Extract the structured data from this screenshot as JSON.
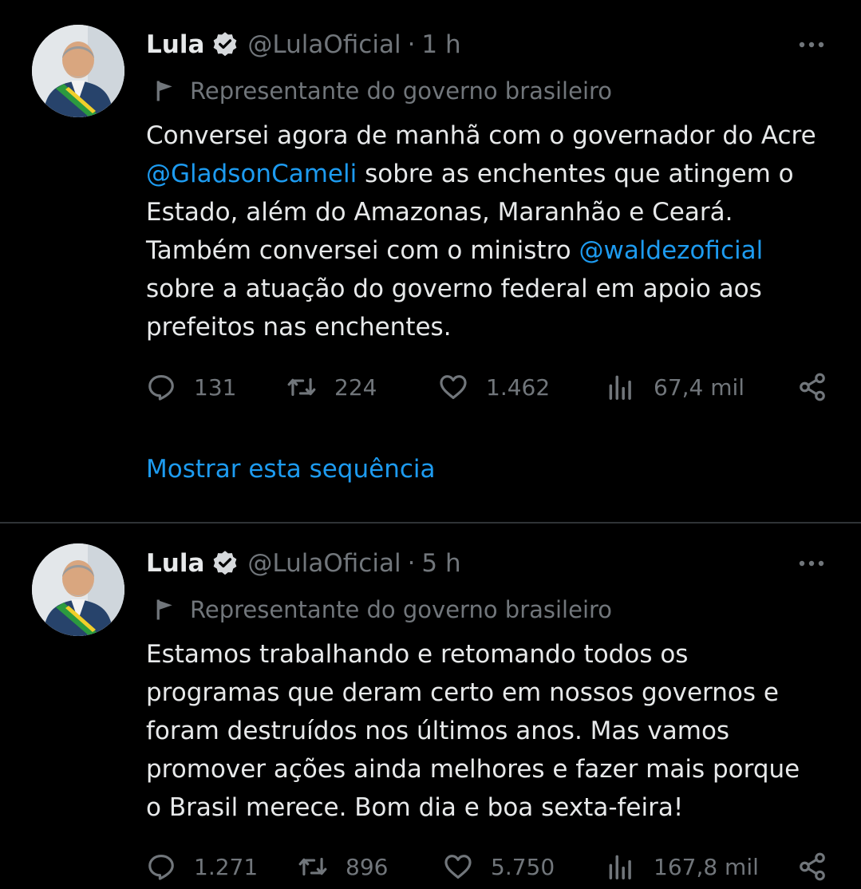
{
  "colors": {
    "background": "#000000",
    "text": "#e7e9ea",
    "muted": "#71767b",
    "accent": "#1d9bf0",
    "divider": "#2f3336"
  },
  "tweets": [
    {
      "author_name": "Lula",
      "handle": "@LulaOficial",
      "separator": "·",
      "time": "1 h",
      "label": "Representante do governo brasileiro",
      "lines": [
        [
          {
            "text": "Conversei agora de manhã com o governador do Acre"
          }
        ],
        [
          {
            "text": "@GladsonCameli",
            "mention": true
          },
          {
            "text": " sobre as enchentes que atingem o"
          }
        ],
        [
          {
            "text": "Estado, além do Amazonas, Maranhão e Ceará."
          }
        ],
        [
          {
            "text": "Também conversei com o ministro "
          },
          {
            "text": "@waldezoficial",
            "mention": true
          }
        ],
        [
          {
            "text": "sobre a atuação do governo federal em apoio aos"
          }
        ],
        [
          {
            "text": "prefeitos nas enchentes."
          }
        ]
      ],
      "replies": "131",
      "retweets": "224",
      "likes": "1.462",
      "views": "67,4 mil",
      "show_thread": "Mostrar esta sequência"
    },
    {
      "author_name": "Lula",
      "handle": "@LulaOficial",
      "separator": "·",
      "time": "5 h",
      "label": "Representante do governo brasileiro",
      "lines": [
        [
          {
            "text": "Estamos trabalhando e retomando todos os"
          }
        ],
        [
          {
            "text": "programas que deram certo em nossos governos e"
          }
        ],
        [
          {
            "text": "foram destruídos nos últimos anos. Mas vamos"
          }
        ],
        [
          {
            "text": "promover ações ainda melhores e fazer mais porque"
          }
        ],
        [
          {
            "text": "o Brasil merece. Bom dia e boa sexta-feira!"
          }
        ]
      ],
      "replies": "1.271",
      "retweets": "896",
      "likes": "5.750",
      "views": "167,8 mil"
    }
  ],
  "icons": {
    "avatar": "avatar",
    "verified": "verified-badge-icon",
    "more": "more-icon",
    "label": "flag-icon",
    "reply": "reply-icon",
    "retweet": "retweet-icon",
    "like": "like-icon",
    "views": "views-icon",
    "share": "share-icon"
  }
}
